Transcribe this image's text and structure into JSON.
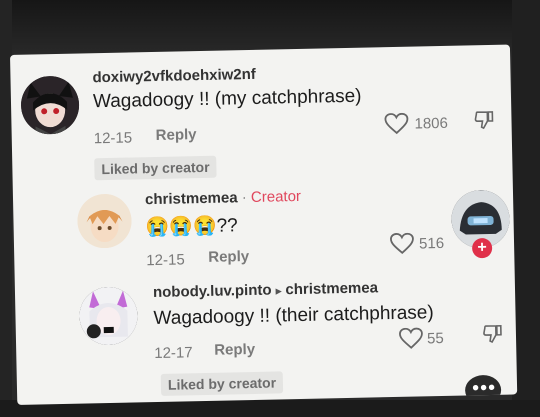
{
  "comments": [
    {
      "username": "doxiwy2vfkdoehxiw2nf",
      "text": "Wagadoogy !! (my catchphrase)",
      "date": "12-15",
      "reply_label": "Reply",
      "likes": "1806",
      "liked_by_creator": "Liked by creator"
    },
    {
      "username": "christmemea",
      "separator": "·",
      "creator_label": "Creator",
      "text": "😭😭😭??",
      "date": "12-15",
      "reply_label": "Reply",
      "likes": "516"
    },
    {
      "username": "nobody.luv.pinto",
      "reply_to_arrow": "▸",
      "reply_to": "christmemea",
      "text": "Wagadoogy !! (their catchphrase)",
      "date": "12-17",
      "reply_label": "Reply",
      "likes": "55",
      "liked_by_creator": "Liked by creator"
    }
  ],
  "colors": {
    "background": "#f3f3f1",
    "creator_accent": "#e0475d",
    "follow_button": "#e0304a"
  }
}
